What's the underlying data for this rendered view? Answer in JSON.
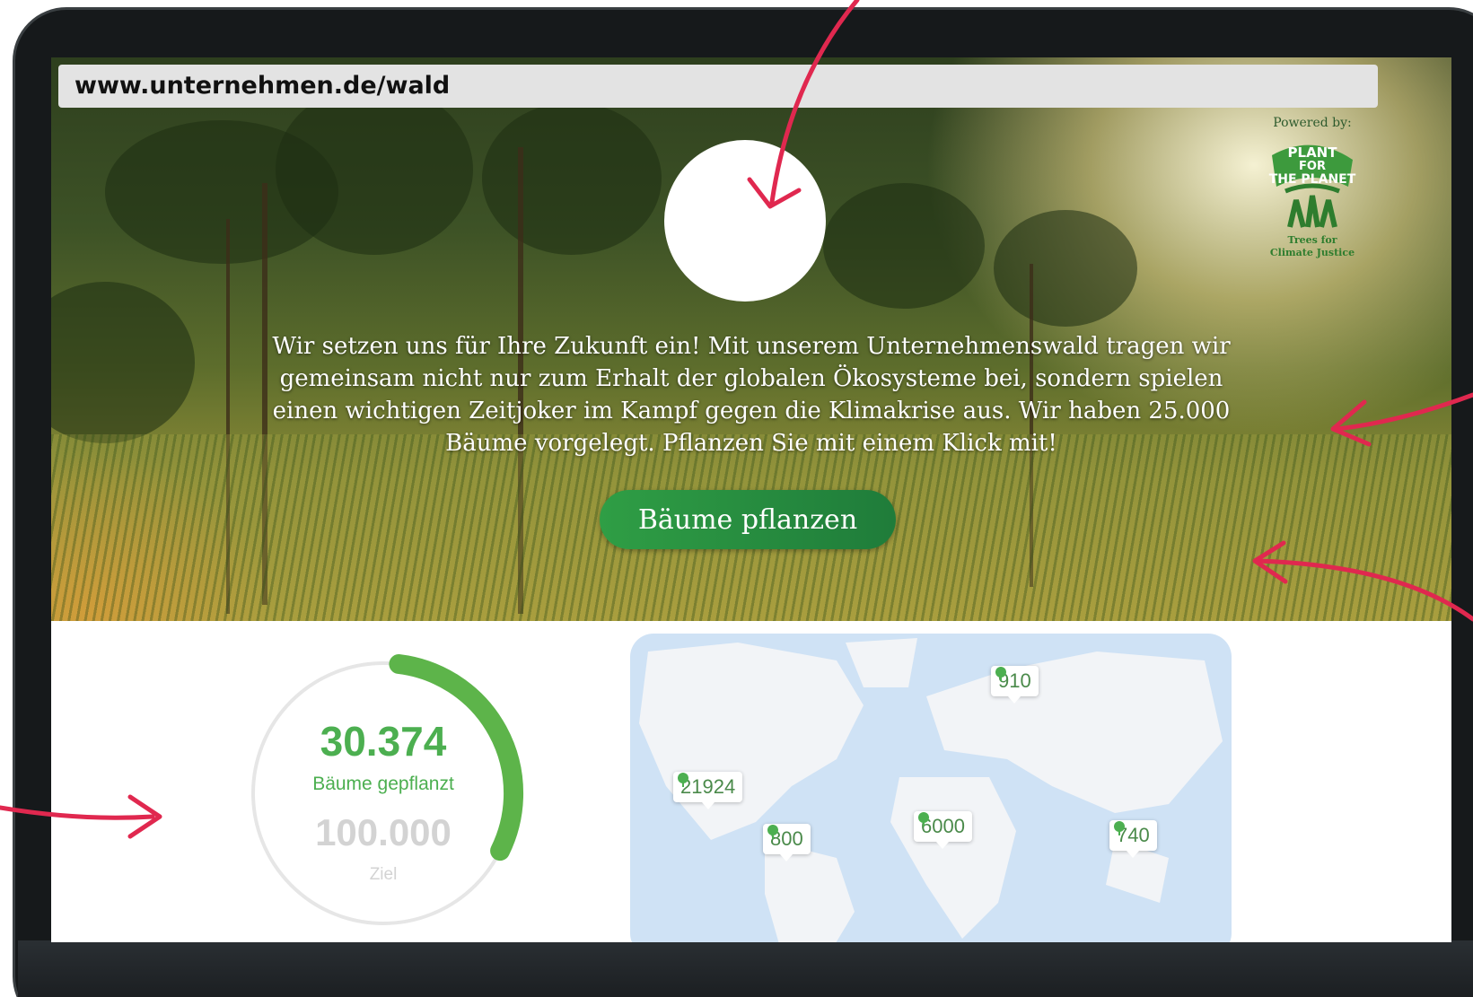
{
  "browser": {
    "url": "www.unternehmen.de/wald"
  },
  "hero": {
    "text": "Wir setzen uns für Ihre Zukunft ein! Mit unserem Unternehmenswald tragen wir gemeinsam nicht nur zum Erhalt der globalen Ökosysteme bei, sondern spielen einen wichtigen Zeitjoker im Kampf gegen die Klimakrise aus. Wir haben 25.000 Bäume vorgelegt. Pflanzen Sie mit einem Klick mit!",
    "button_label": "Bäume pflanzen",
    "powered_by": "Powered by:",
    "partner_logo_text": [
      "PLANT",
      "FOR",
      "THE PLANET",
      "Trees for",
      "Climate Justice"
    ]
  },
  "progress": {
    "planted": "30.374",
    "planted_label": "Bäume gepflanzt",
    "goal": "100.000",
    "goal_label": "Ziel",
    "fraction": 0.30374
  },
  "map": {
    "pins": [
      {
        "value": "910",
        "icon": "tree-icon"
      },
      {
        "value": "21924",
        "icon": "tree-icon"
      },
      {
        "value": "800",
        "icon": "tree-icon"
      },
      {
        "value": "6000",
        "icon": "tree-icon"
      },
      {
        "value": "740",
        "icon": "tree-icon"
      }
    ]
  },
  "colors": {
    "accent_green": "#4caf50",
    "button_green": "#2f9e45",
    "annotation_red": "#e0284f",
    "map_water": "#cfe2f5",
    "map_land": "#f2f4f7"
  }
}
